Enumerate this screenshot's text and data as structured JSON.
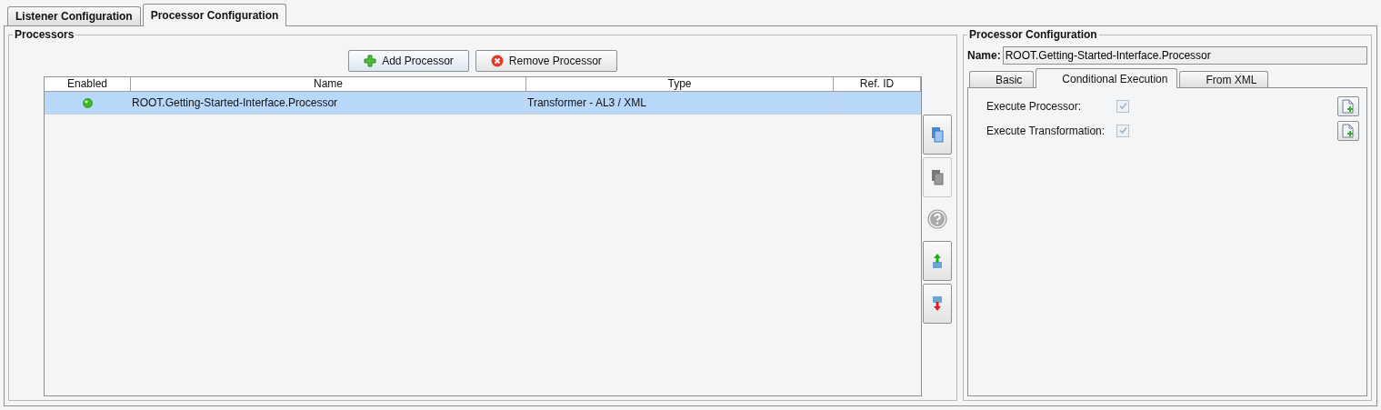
{
  "tabs": [
    {
      "label": "Listener Configuration",
      "selected": false
    },
    {
      "label": "Processor Configuration",
      "selected": true
    }
  ],
  "processors": {
    "title": "Processors",
    "buttons": [
      {
        "label": "Add Processor",
        "kind": "add"
      },
      {
        "label": "Remove Processor",
        "kind": "remove"
      }
    ],
    "table": {
      "columns": [
        "Enabled",
        "Name",
        "Type",
        "Ref. ID"
      ],
      "rows": [
        {
          "enabled": true,
          "name": "ROOT.Getting-Started-Interface.Processor",
          "type": "Transformer - AL3 / XML",
          "selected": true
        }
      ]
    },
    "side_buttons": [
      {
        "kind": "copy",
        "disabled": false
      },
      {
        "kind": "paste",
        "disabled": true
      },
      {
        "kind": "help",
        "disabled": true
      },
      {
        "kind": "up",
        "disabled": false
      },
      {
        "kind": "down",
        "disabled": false
      }
    ]
  },
  "config": {
    "title": "Processor Configuration",
    "name_label": "Name:",
    "name_value": "ROOT.Getting-Started-Interface.Processor",
    "tabs": [
      {
        "label": "Basic",
        "selected": false
      },
      {
        "label": "Conditional Execution",
        "selected": true
      },
      {
        "label": "From XML",
        "selected": false
      }
    ],
    "options": [
      {
        "label": "Execute Processor:",
        "checked": true,
        "disabled": true
      },
      {
        "label": "Execute Transformation:",
        "checked": true,
        "disabled": true
      }
    ]
  }
}
